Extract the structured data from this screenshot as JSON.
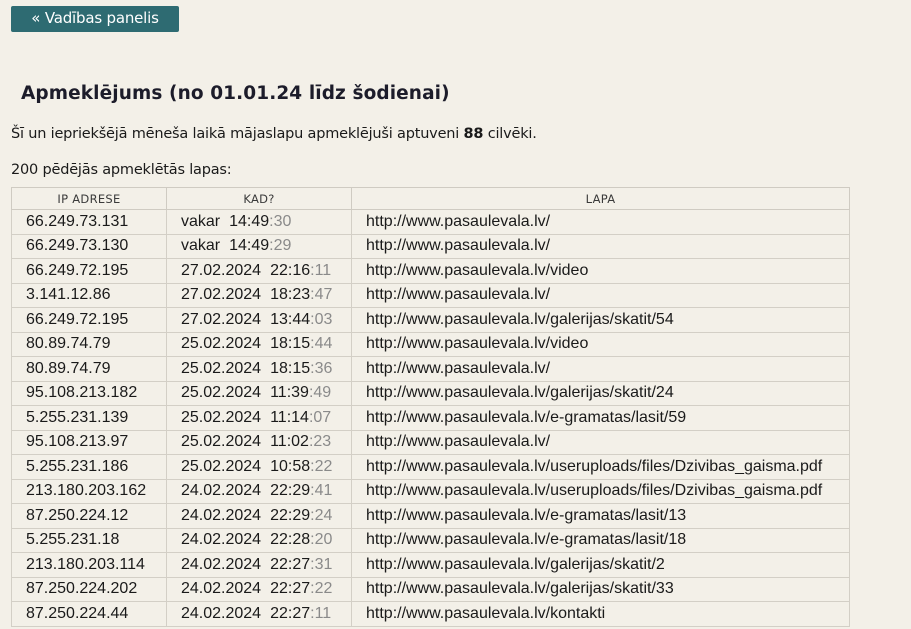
{
  "back_button": {
    "label": "« Vadības panelis"
  },
  "heading": {
    "title": "Apmeklējums (no 01.01.24 līdz šodienai)"
  },
  "summary": {
    "before": "Šī un iepriekšējā mēneša laikā mājaslapu apmeklējuši aptuveni ",
    "count": "88",
    "after": " cilvēki."
  },
  "list_caption": "200 pēdējās apmeklētās lapas:",
  "table": {
    "headers": {
      "ip": "IP ADRESE",
      "when": "KAD?",
      "page": "LAPA"
    },
    "rows": [
      {
        "ip": "66.249.73.131",
        "date": "vakar",
        "time": "14:49",
        "sec": ":30",
        "page": "http://www.pasaulevala.lv/"
      },
      {
        "ip": "66.249.73.130",
        "date": "vakar",
        "time": "14:49",
        "sec": ":29",
        "page": "http://www.pasaulevala.lv/"
      },
      {
        "ip": "66.249.72.195",
        "date": "27.02.2024",
        "time": "22:16",
        "sec": ":11",
        "page": "http://www.pasaulevala.lv/video"
      },
      {
        "ip": "3.141.12.86",
        "date": "27.02.2024",
        "time": "18:23",
        "sec": ":47",
        "page": "http://www.pasaulevala.lv/"
      },
      {
        "ip": "66.249.72.195",
        "date": "27.02.2024",
        "time": "13:44",
        "sec": ":03",
        "page": "http://www.pasaulevala.lv/galerijas/skatit/54"
      },
      {
        "ip": "80.89.74.79",
        "date": "25.02.2024",
        "time": "18:15",
        "sec": ":44",
        "page": "http://www.pasaulevala.lv/video"
      },
      {
        "ip": "80.89.74.79",
        "date": "25.02.2024",
        "time": "18:15",
        "sec": ":36",
        "page": "http://www.pasaulevala.lv/"
      },
      {
        "ip": "95.108.213.182",
        "date": "25.02.2024",
        "time": "11:39",
        "sec": ":49",
        "page": "http://www.pasaulevala.lv/galerijas/skatit/24"
      },
      {
        "ip": "5.255.231.139",
        "date": "25.02.2024",
        "time": "11:14",
        "sec": ":07",
        "page": "http://www.pasaulevala.lv/e-gramatas/lasit/59"
      },
      {
        "ip": "95.108.213.97",
        "date": "25.02.2024",
        "time": "11:02",
        "sec": ":23",
        "page": "http://www.pasaulevala.lv/"
      },
      {
        "ip": "5.255.231.186",
        "date": "25.02.2024",
        "time": "10:58",
        "sec": ":22",
        "page": "http://www.pasaulevala.lv/useruploads/files/Dzivibas_gaisma.pdf"
      },
      {
        "ip": "213.180.203.162",
        "date": "24.02.2024",
        "time": "22:29",
        "sec": ":41",
        "page": "http://www.pasaulevala.lv/useruploads/files/Dzivibas_gaisma.pdf"
      },
      {
        "ip": "87.250.224.12",
        "date": "24.02.2024",
        "time": "22:29",
        "sec": ":24",
        "page": "http://www.pasaulevala.lv/e-gramatas/lasit/13"
      },
      {
        "ip": "5.255.231.18",
        "date": "24.02.2024",
        "time": "22:28",
        "sec": ":20",
        "page": "http://www.pasaulevala.lv/e-gramatas/lasit/18"
      },
      {
        "ip": "213.180.203.114",
        "date": "24.02.2024",
        "time": "22:27",
        "sec": ":31",
        "page": "http://www.pasaulevala.lv/galerijas/skatit/2"
      },
      {
        "ip": "87.250.224.202",
        "date": "24.02.2024",
        "time": "22:27",
        "sec": ":22",
        "page": "http://www.pasaulevala.lv/galerijas/skatit/33"
      },
      {
        "ip": "87.250.224.44",
        "date": "24.02.2024",
        "time": "22:27",
        "sec": ":11",
        "page": "http://www.pasaulevala.lv/kontakti"
      }
    ]
  },
  "colors": {
    "background": "#f3f0e8",
    "button": "#2e6b72",
    "seconds_text": "#8a8a8a"
  }
}
